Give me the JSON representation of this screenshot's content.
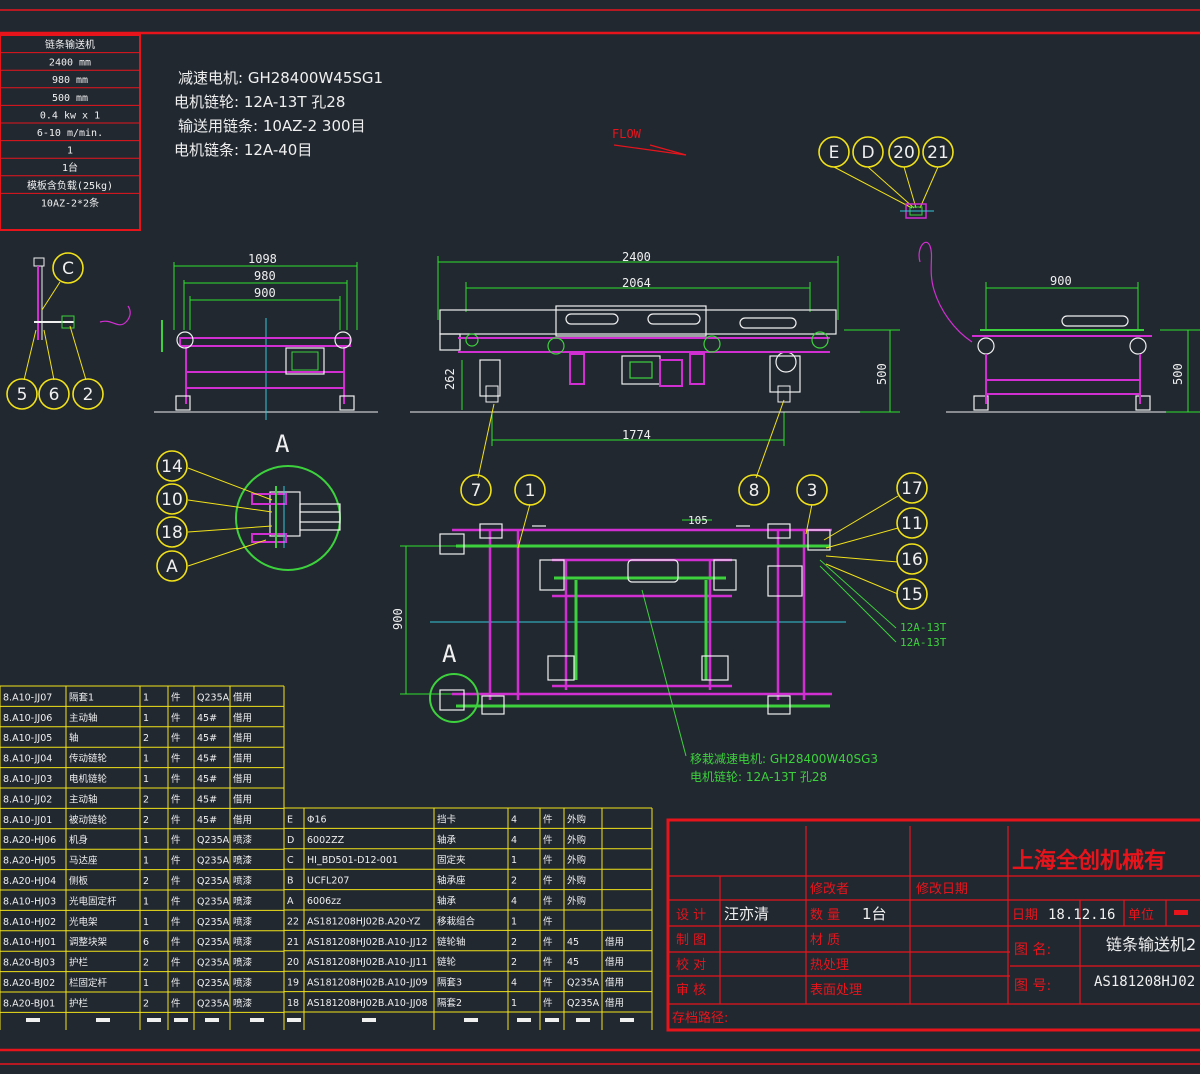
{
  "colors": {
    "background": "#212830",
    "frame": "#e8141c",
    "table_line": "#f2e21a",
    "magenta": "#d22fd2",
    "green": "#3dd13d",
    "cyan": "#35c9d8",
    "white": "#f0f0f0",
    "yellow": "#f2e21a",
    "dim_green": "#2ee02e"
  },
  "spec_table": {
    "header": "链条输送机",
    "rows": [
      "2400 mm",
      "980 mm",
      "500 mm",
      "0.4 kw x 1",
      "6-10 m/min.",
      "1",
      "1台",
      "模板含负载(25kg)",
      "10AZ-2*2条"
    ]
  },
  "notes": [
    "减速电机: GH28400W45SG1",
    "电机链轮: 12A-13T 孔28",
    "输送用链条: 10AZ-2  300目",
    "电机链条: 12A-40目"
  ],
  "flow_label": "FLOW",
  "balloons_top_right": [
    "E",
    "D",
    "20",
    "21"
  ],
  "balloons_left": [
    "C",
    "5",
    "6",
    "2"
  ],
  "balloons_detail": [
    "14",
    "10",
    "18",
    "A"
  ],
  "balloons_main": [
    "7",
    "1",
    "8",
    "3"
  ],
  "balloons_right": [
    "17",
    "11",
    "16",
    "15"
  ],
  "detail_label": "A",
  "dimensions": {
    "side_1098": "1098",
    "side_980": "980",
    "side_900": "900",
    "front_2400": "2400",
    "front_2064": "2064",
    "front_262": "262",
    "front_500": "500",
    "front_1774": "1774",
    "end_900": "900",
    "end_500": "500",
    "plan_105": "105",
    "plan_900": "900"
  },
  "sprocket_labels": [
    "12A-13T",
    "12A-13T"
  ],
  "plan_notes": [
    "移栽减速电机: GH28400W40SG3",
    "电机链轮: 12A-13T 孔28"
  ],
  "bom_left": [
    [
      "8.A10-JJ07",
      "隔套1",
      "1",
      "件",
      "Q235A",
      "借用"
    ],
    [
      "8.A10-JJ06",
      "主动轴",
      "1",
      "件",
      "45#",
      "借用"
    ],
    [
      "8.A10-JJ05",
      "轴",
      "2",
      "件",
      "45#",
      "借用"
    ],
    [
      "8.A10-JJ04",
      "传动链轮",
      "1",
      "件",
      "45#",
      "借用"
    ],
    [
      "8.A10-JJ03",
      "电机链轮",
      "1",
      "件",
      "45#",
      "借用"
    ],
    [
      "8.A10-JJ02",
      "主动轴",
      "2",
      "件",
      "45#",
      "借用"
    ],
    [
      "8.A10-JJ01",
      "被动链轮",
      "2",
      "件",
      "45#",
      "借用"
    ],
    [
      "8.A20-HJ06",
      "机身",
      "1",
      "件",
      "Q235A",
      "喷漆"
    ],
    [
      "8.A20-HJ05",
      "马达座",
      "1",
      "件",
      "Q235A",
      "喷漆"
    ],
    [
      "8.A20-HJ04",
      "侧板",
      "2",
      "件",
      "Q235A",
      "喷漆"
    ],
    [
      "8.A10-HJ03",
      "光电固定杆",
      "1",
      "件",
      "Q235A",
      "喷漆"
    ],
    [
      "8.A10-HJ02",
      "光电架",
      "1",
      "件",
      "Q235A",
      "喷漆"
    ],
    [
      "8.A10-HJ01",
      "调整块架",
      "6",
      "件",
      "Q235A",
      "喷漆"
    ],
    [
      "8.A20-BJ03",
      "护栏",
      "2",
      "件",
      "Q235A",
      "喷漆"
    ],
    [
      "8.A20-BJ02",
      "栏固定杆",
      "1",
      "件",
      "Q235A",
      "喷漆"
    ],
    [
      "8.A20-BJ01",
      "护栏",
      "2",
      "件",
      "Q235A",
      "喷漆"
    ]
  ],
  "bom_right": [
    [
      "E",
      "Φ16",
      "挡卡",
      "4",
      "件",
      "外购",
      ""
    ],
    [
      "D",
      "6002ZZ",
      "轴承",
      "4",
      "件",
      "外购",
      ""
    ],
    [
      "C",
      "HI_BD501-D12-001",
      "固定夹",
      "1",
      "件",
      "外购",
      ""
    ],
    [
      "B",
      "UCFL207",
      "轴承座",
      "2",
      "件",
      "外购",
      ""
    ],
    [
      "A",
      "6006zz",
      "轴承",
      "4",
      "件",
      "外购",
      ""
    ],
    [
      "22",
      "AS181208HJ02B.A20-YZ",
      "移栽组合",
      "1",
      "件",
      "",
      ""
    ],
    [
      "21",
      "AS181208HJ02B.A10-JJ12",
      "链轮轴",
      "2",
      "件",
      "45",
      "借用"
    ],
    [
      "20",
      "AS181208HJ02B.A10-JJ11",
      "链轮",
      "2",
      "件",
      "45",
      "借用"
    ],
    [
      "19",
      "AS181208HJ02B.A10-JJ09",
      "隔套3",
      "4",
      "件",
      "Q235A",
      "借用"
    ],
    [
      "18",
      "AS181208HJ02B.A10-JJ08",
      "隔套2",
      "1",
      "件",
      "Q235A",
      "借用"
    ]
  ],
  "title_block": {
    "company": "上海全创机械有",
    "modifier": "修改者",
    "modify_date": "修改日期",
    "design_label": "设 计",
    "designer": "汪亦清",
    "qty_label": "数 量",
    "qty": "1台",
    "date_label": "日期",
    "date": "18.12.16",
    "unit_label": "单位",
    "draw_label": "制 图",
    "material_label": "材 质",
    "name_label": "图 名:",
    "drawing_name": "链条输送机2",
    "check_label": "校 对",
    "heat_label": "热处理",
    "audit_label": "审 核",
    "surface_label": "表面处理",
    "number_label": "图 号:",
    "drawing_number": "AS181208HJ02",
    "path_label": "存档路径:"
  }
}
